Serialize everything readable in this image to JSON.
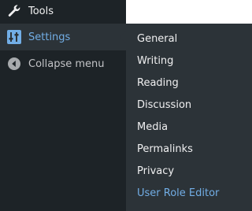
{
  "sidebar": {
    "items": [
      {
        "label": "Tools",
        "icon": "wrench-icon"
      },
      {
        "label": "Settings",
        "icon": "settings-icon"
      },
      {
        "label": "Collapse menu",
        "icon": "collapse-icon"
      }
    ]
  },
  "submenu": {
    "items": [
      {
        "label": "General"
      },
      {
        "label": "Writing"
      },
      {
        "label": "Reading"
      },
      {
        "label": "Discussion"
      },
      {
        "label": "Media"
      },
      {
        "label": "Permalinks"
      },
      {
        "label": "Privacy"
      },
      {
        "label": "User Role Editor"
      }
    ]
  },
  "colors": {
    "sidebar_bg": "#1d2327",
    "submenu_bg": "#2c3338",
    "accent": "#72aee6",
    "text": "#f0f0f1"
  }
}
